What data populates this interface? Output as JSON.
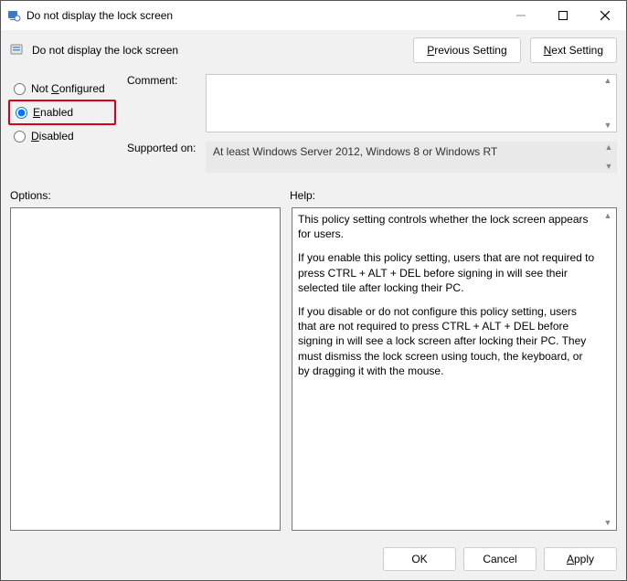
{
  "window": {
    "title": "Do not display the lock screen"
  },
  "header": {
    "title": "Do not display the lock screen",
    "prev_P": "P",
    "prev_rest": "revious Setting",
    "next_N": "N",
    "next_rest": "ext Setting"
  },
  "radios": {
    "not_configured_C": "C",
    "not_configured_pre": "Not ",
    "not_configured_post": "onfigured",
    "enabled_E": "E",
    "enabled_post": "nabled",
    "disabled_D": "D",
    "disabled_post": "isabled",
    "selected": "enabled"
  },
  "labels": {
    "comment": "Comment:",
    "supported": "Supported on:",
    "options": "Options:",
    "help": "Help:"
  },
  "supported_text": "At least Windows Server 2012, Windows 8 or Windows RT",
  "help_text": {
    "p1": "This policy setting controls whether the lock screen appears for users.",
    "p2": "If you enable this policy setting, users that are not required to press CTRL + ALT + DEL before signing in will see their selected tile after locking their PC.",
    "p3": "If you disable or do not configure this policy setting, users that are not required to press CTRL + ALT + DEL before signing in will see a lock screen after locking their PC. They must dismiss the lock screen using touch, the keyboard, or by dragging it with the mouse."
  },
  "buttons": {
    "ok": "OK",
    "cancel": "Cancel",
    "apply_A": "A",
    "apply_post": "pply"
  }
}
